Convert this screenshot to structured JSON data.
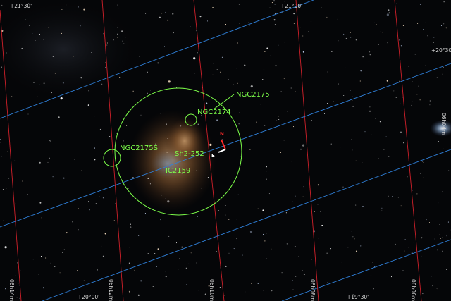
{
  "objects": {
    "ngc2175": "NGC2175",
    "ngc2174": "NGC2174",
    "ngc2175s": "NGC2175S",
    "sh2_252": "Sh2-252",
    "ic2159": "IC2159"
  },
  "compass": {
    "north": "N",
    "east": "E"
  },
  "dec_labels": {
    "dec_21_30": "+21°30'",
    "dec_21_00": "+21°00'",
    "dec_20_30": "+20°30'",
    "dec_20_00": "+20°00'",
    "dec_19_30": "+19°30'"
  },
  "ra_labels": {
    "ra_06h14m": "06h14m",
    "ra_06h12m": "06h12m",
    "ra_06h10m": "06h10m",
    "ra_06h08m": "06h08m",
    "ra_06h06m": "06h06m",
    "ra_06h04m": "06h04m"
  },
  "colors": {
    "ra_grid": "#d0202a",
    "dec_grid": "#2f7fd8",
    "annotation": "#7dff4a",
    "north_arrow": "#ff2a2a",
    "east_arrow": "#ffffff",
    "nebula": "#b0743a"
  }
}
